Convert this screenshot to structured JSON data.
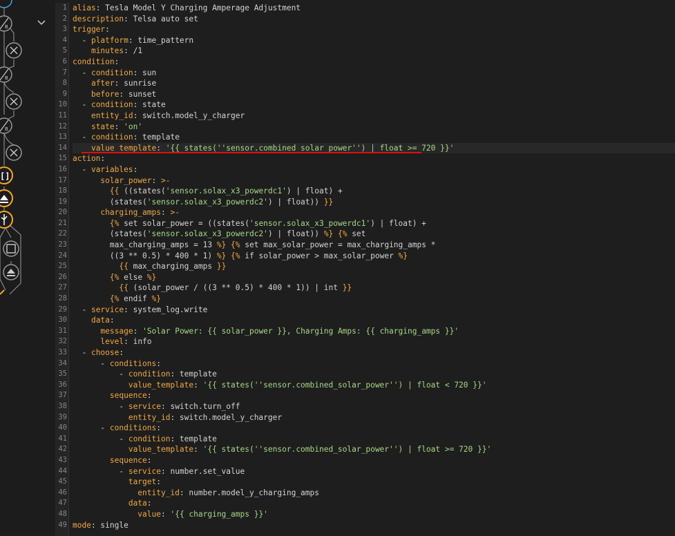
{
  "colors": {
    "key": "#f0a844",
    "string": "#a6d887",
    "plain": "#d4d4d4",
    "accent": "#f5a623",
    "highlight": "#e01010"
  },
  "sidebar": {
    "icons": [
      "edit-icon",
      "ab-icon",
      "close-icon",
      "ab-icon",
      "close-icon",
      "ab-icon",
      "close-icon",
      "bracket-icon",
      "eject-icon",
      "usb-icon",
      "stop-icon",
      "eject-icon"
    ],
    "collapse_icon": "chevron-down-icon"
  },
  "editor": {
    "highlight_line": 14,
    "lines": [
      {
        "n": "1",
        "t": [
          [
            "k",
            "alias"
          ],
          [
            "p",
            ": Tesla Model Y Charging Amperage Adjustment"
          ]
        ]
      },
      {
        "n": "2",
        "t": [
          [
            "k",
            "description"
          ],
          [
            "p",
            ": Telsa auto set"
          ]
        ]
      },
      {
        "n": "3",
        "t": [
          [
            "k",
            "trigger"
          ],
          [
            "p",
            ":"
          ]
        ]
      },
      {
        "n": "4",
        "t": [
          [
            "p",
            "  - "
          ],
          [
            "k",
            "platform"
          ],
          [
            "p",
            ": time_pattern"
          ]
        ]
      },
      {
        "n": "5",
        "t": [
          [
            "p",
            "    "
          ],
          [
            "k",
            "minutes"
          ],
          [
            "p",
            ": /1"
          ]
        ]
      },
      {
        "n": "6",
        "t": [
          [
            "k",
            "condition"
          ],
          [
            "p",
            ":"
          ]
        ]
      },
      {
        "n": "7",
        "t": [
          [
            "p",
            "  - "
          ],
          [
            "k",
            "condition"
          ],
          [
            "p",
            ": sun"
          ]
        ]
      },
      {
        "n": "8",
        "t": [
          [
            "p",
            "    "
          ],
          [
            "k",
            "after"
          ],
          [
            "p",
            ": sunrise"
          ]
        ]
      },
      {
        "n": "9",
        "t": [
          [
            "p",
            "    "
          ],
          [
            "k",
            "before"
          ],
          [
            "p",
            ": sunset"
          ]
        ]
      },
      {
        "n": "10",
        "t": [
          [
            "p",
            "  - "
          ],
          [
            "k",
            "condition"
          ],
          [
            "p",
            ": state"
          ]
        ]
      },
      {
        "n": "11",
        "t": [
          [
            "p",
            "    "
          ],
          [
            "k",
            "entity_id"
          ],
          [
            "p",
            ": switch.model_y_charger"
          ]
        ]
      },
      {
        "n": "12",
        "t": [
          [
            "p",
            "    "
          ],
          [
            "k",
            "state"
          ],
          [
            "p",
            ": "
          ],
          [
            "s",
            "'on'"
          ]
        ]
      },
      {
        "n": "13",
        "t": [
          [
            "p",
            "  - "
          ],
          [
            "k",
            "condition"
          ],
          [
            "p",
            ": template"
          ]
        ]
      },
      {
        "n": "14",
        "t": [
          [
            "p",
            "    "
          ],
          [
            "k",
            "value_template"
          ],
          [
            "p",
            ": "
          ],
          [
            "s",
            "'{{ states(''sensor.combined_solar_power'') | float >= 720 }}'"
          ]
        ]
      },
      {
        "n": "15",
        "t": [
          [
            "k",
            "action"
          ],
          [
            "p",
            ":"
          ]
        ]
      },
      {
        "n": "16",
        "t": [
          [
            "p",
            "  - "
          ],
          [
            "k",
            "variables"
          ],
          [
            "p",
            ":"
          ]
        ]
      },
      {
        "n": "17",
        "t": [
          [
            "p",
            "      "
          ],
          [
            "k",
            "solar_power"
          ],
          [
            "p",
            ": "
          ],
          [
            "k",
            ">-"
          ]
        ]
      },
      {
        "n": "18",
        "t": [
          [
            "p",
            "        "
          ],
          [
            "k",
            "{{"
          ],
          [
            "p",
            " ((states("
          ],
          [
            "s",
            "'sensor.solax_x3_powerdc1'"
          ],
          [
            "p",
            ") | float) +"
          ]
        ]
      },
      {
        "n": "19",
        "t": [
          [
            "p",
            "        (states("
          ],
          [
            "s",
            "'sensor.solax_x3_powerdc2'"
          ],
          [
            "p",
            ") | float)) "
          ],
          [
            "k",
            "}}"
          ]
        ]
      },
      {
        "n": "20",
        "t": [
          [
            "p",
            "      "
          ],
          [
            "k",
            "charging_amps"
          ],
          [
            "p",
            ": "
          ],
          [
            "k",
            ">-"
          ]
        ]
      },
      {
        "n": "21",
        "t": [
          [
            "p",
            "        "
          ],
          [
            "k",
            "{%"
          ],
          [
            "p",
            " set solar_power = ((states("
          ],
          [
            "s",
            "'sensor.solax_x3_powerdc1'"
          ],
          [
            "p",
            ") | float) +"
          ]
        ]
      },
      {
        "n": "22",
        "t": [
          [
            "p",
            "        (states("
          ],
          [
            "s",
            "'sensor.solax_x3_powerdc2'"
          ],
          [
            "p",
            ") | float)) "
          ],
          [
            "k",
            "%}"
          ],
          [
            "p",
            " "
          ],
          [
            "k",
            "{%"
          ],
          [
            "p",
            " set"
          ]
        ]
      },
      {
        "n": "23",
        "t": [
          [
            "p",
            "        max_charging_amps = 13 "
          ],
          [
            "k",
            "%}"
          ],
          [
            "p",
            " "
          ],
          [
            "k",
            "{%"
          ],
          [
            "p",
            " set max_solar_power = max_charging_amps *"
          ]
        ]
      },
      {
        "n": "24",
        "t": [
          [
            "p",
            "        ((3 ** 0.5) * 400 * 1) "
          ],
          [
            "k",
            "%}"
          ],
          [
            "p",
            " "
          ],
          [
            "k",
            "{%"
          ],
          [
            "p",
            " if solar_power > max_solar_power "
          ],
          [
            "k",
            "%}"
          ]
        ]
      },
      {
        "n": "25",
        "t": [
          [
            "p",
            "          "
          ],
          [
            "k",
            "{{"
          ],
          [
            "p",
            " max_charging_amps "
          ],
          [
            "k",
            "}}"
          ]
        ]
      },
      {
        "n": "26",
        "t": [
          [
            "p",
            "        "
          ],
          [
            "k",
            "{%"
          ],
          [
            "p",
            " else "
          ],
          [
            "k",
            "%}"
          ]
        ]
      },
      {
        "n": "27",
        "t": [
          [
            "p",
            "          "
          ],
          [
            "k",
            "{{"
          ],
          [
            "p",
            " (solar_power / ((3 ** 0.5) * 400 * 1)) | int "
          ],
          [
            "k",
            "}}"
          ]
        ]
      },
      {
        "n": "28",
        "t": [
          [
            "p",
            "        "
          ],
          [
            "k",
            "{%"
          ],
          [
            "p",
            " endif "
          ],
          [
            "k",
            "%}"
          ]
        ]
      },
      {
        "n": "29",
        "t": [
          [
            "p",
            "  - "
          ],
          [
            "k",
            "service"
          ],
          [
            "p",
            ": system_log.write"
          ]
        ]
      },
      {
        "n": "30",
        "t": [
          [
            "p",
            "    "
          ],
          [
            "k",
            "data"
          ],
          [
            "p",
            ":"
          ]
        ]
      },
      {
        "n": "31",
        "t": [
          [
            "p",
            "      "
          ],
          [
            "k",
            "message"
          ],
          [
            "p",
            ": "
          ],
          [
            "s",
            "'Solar Power: {{ solar_power }}, Charging Amps: {{ charging_amps }}'"
          ]
        ]
      },
      {
        "n": "32",
        "t": [
          [
            "p",
            "      "
          ],
          [
            "k",
            "level"
          ],
          [
            "p",
            ": info"
          ]
        ]
      },
      {
        "n": "33",
        "t": [
          [
            "p",
            "  - "
          ],
          [
            "k",
            "choose"
          ],
          [
            "p",
            ":"
          ]
        ]
      },
      {
        "n": "34",
        "t": [
          [
            "p",
            "      - "
          ],
          [
            "k",
            "conditions"
          ],
          [
            "p",
            ":"
          ]
        ]
      },
      {
        "n": "35",
        "t": [
          [
            "p",
            "          - "
          ],
          [
            "k",
            "condition"
          ],
          [
            "p",
            ": template"
          ]
        ]
      },
      {
        "n": "36",
        "t": [
          [
            "p",
            "            "
          ],
          [
            "k",
            "value_template"
          ],
          [
            "p",
            ": "
          ],
          [
            "s",
            "'{{ states(''sensor.combined_solar_power'') | float < 720 }}'"
          ]
        ]
      },
      {
        "n": "37",
        "t": [
          [
            "p",
            "        "
          ],
          [
            "k",
            "sequence"
          ],
          [
            "p",
            ":"
          ]
        ]
      },
      {
        "n": "38",
        "t": [
          [
            "p",
            "          - "
          ],
          [
            "k",
            "service"
          ],
          [
            "p",
            ": switch.turn_off"
          ]
        ]
      },
      {
        "n": "39",
        "t": [
          [
            "p",
            "            "
          ],
          [
            "k",
            "entity_id"
          ],
          [
            "p",
            ": switch.model_y_charger"
          ]
        ]
      },
      {
        "n": "40",
        "t": [
          [
            "p",
            "      - "
          ],
          [
            "k",
            "conditions"
          ],
          [
            "p",
            ":"
          ]
        ]
      },
      {
        "n": "41",
        "t": [
          [
            "p",
            "          - "
          ],
          [
            "k",
            "condition"
          ],
          [
            "p",
            ": template"
          ]
        ]
      },
      {
        "n": "42",
        "t": [
          [
            "p",
            "            "
          ],
          [
            "k",
            "value_template"
          ],
          [
            "p",
            ": "
          ],
          [
            "s",
            "'{{ states(''sensor.combined_solar_power'') | float >= 720 }}'"
          ]
        ]
      },
      {
        "n": "43",
        "t": [
          [
            "p",
            "        "
          ],
          [
            "k",
            "sequence"
          ],
          [
            "p",
            ":"
          ]
        ]
      },
      {
        "n": "44",
        "t": [
          [
            "p",
            "          - "
          ],
          [
            "k",
            "service"
          ],
          [
            "p",
            ": number.set_value"
          ]
        ]
      },
      {
        "n": "45",
        "t": [
          [
            "p",
            "            "
          ],
          [
            "k",
            "target"
          ],
          [
            "p",
            ":"
          ]
        ]
      },
      {
        "n": "46",
        "t": [
          [
            "p",
            "              "
          ],
          [
            "k",
            "entity_id"
          ],
          [
            "p",
            ": number.model_y_charging_amps"
          ]
        ]
      },
      {
        "n": "47",
        "t": [
          [
            "p",
            "            "
          ],
          [
            "k",
            "data"
          ],
          [
            "p",
            ":"
          ]
        ]
      },
      {
        "n": "48",
        "t": [
          [
            "p",
            "              "
          ],
          [
            "k",
            "value"
          ],
          [
            "p",
            ": "
          ],
          [
            "s",
            "'{{ charging_amps }}'"
          ]
        ]
      },
      {
        "n": "49",
        "t": [
          [
            "k",
            "mode"
          ],
          [
            "p",
            ": single"
          ]
        ]
      }
    ]
  }
}
